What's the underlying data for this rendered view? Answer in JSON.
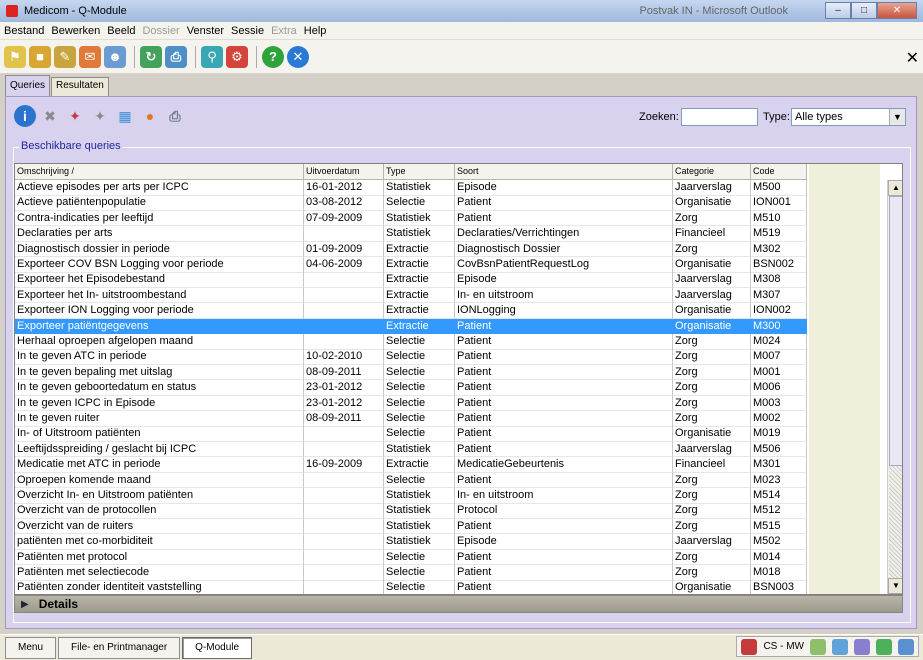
{
  "window": {
    "title": "Medicom - Q-Module",
    "blur_text": "Postvak IN - Microsoft Outlook"
  },
  "menu": {
    "items": [
      {
        "label": "Bestand",
        "enabled": true
      },
      {
        "label": "Bewerken",
        "enabled": true
      },
      {
        "label": "Beeld",
        "enabled": true
      },
      {
        "label": "Dossier",
        "enabled": false
      },
      {
        "label": "Venster",
        "enabled": true
      },
      {
        "label": "Sessie",
        "enabled": true
      },
      {
        "label": "Extra",
        "enabled": false
      },
      {
        "label": "Help",
        "enabled": true
      }
    ]
  },
  "tabs": [
    {
      "label": "Queries",
      "active": true
    },
    {
      "label": "Resultaten",
      "active": false
    }
  ],
  "search": {
    "label": "Zoeken:",
    "value": ""
  },
  "type_filter": {
    "label": "Type:",
    "value": "Alle types"
  },
  "group": {
    "title": "Beschikbare queries"
  },
  "grid": {
    "columns": [
      "Omschrijving /",
      "Uitvoerdatum",
      "Type",
      "Soort",
      "Categorie",
      "Code"
    ],
    "rows": [
      [
        "Actieve episodes per arts per ICPC",
        "16-01-2012",
        "Statistiek",
        "Episode",
        "Jaarverslag",
        "M500"
      ],
      [
        "Actieve patiëntenpopulatie",
        "03-08-2012",
        "Selectie",
        "Patient",
        "Organisatie",
        "ION001"
      ],
      [
        "Contra-indicaties per leeftijd",
        "07-09-2009",
        "Statistiek",
        "Patient",
        "Zorg",
        "M510"
      ],
      [
        "Declaraties per arts",
        "",
        "Statistiek",
        "Declaraties/Verrichtingen",
        "Financieel",
        "M519"
      ],
      [
        "Diagnostisch dossier in periode",
        "01-09-2009",
        "Extractie",
        "Diagnostisch Dossier",
        "Zorg",
        "M302"
      ],
      [
        "Exporteer COV BSN Logging voor periode",
        "04-06-2009",
        "Extractie",
        "CovBsnPatientRequestLog",
        "Organisatie",
        "BSN002"
      ],
      [
        "Exporteer het Episodebestand",
        "",
        "Extractie",
        "Episode",
        "Jaarverslag",
        "M308"
      ],
      [
        "Exporteer het In- uitstroombestand",
        "",
        "Extractie",
        "In- en uitstroom",
        "Jaarverslag",
        "M307"
      ],
      [
        "Exporteer ION Logging voor periode",
        "",
        "Extractie",
        "IONLogging",
        "Organisatie",
        "ION002"
      ],
      [
        "Exporteer patiëntgegevens",
        "",
        "Extractie",
        "Patient",
        "Organisatie",
        "M300"
      ],
      [
        "Herhaal oproepen afgelopen maand",
        "",
        "Selectie",
        "Patient",
        "Zorg",
        "M024"
      ],
      [
        "In te geven ATC in periode",
        "10-02-2010",
        "Selectie",
        "Patient",
        "Zorg",
        "M007"
      ],
      [
        "In te geven bepaling met uitslag",
        "08-09-2011",
        "Selectie",
        "Patient",
        "Zorg",
        "M001"
      ],
      [
        "In te geven geboortedatum en status",
        "23-01-2012",
        "Selectie",
        "Patient",
        "Zorg",
        "M006"
      ],
      [
        "In te geven ICPC in Episode",
        "23-01-2012",
        "Selectie",
        "Patient",
        "Zorg",
        "M003"
      ],
      [
        "In te geven ruiter",
        "08-09-2011",
        "Selectie",
        "Patient",
        "Zorg",
        "M002"
      ],
      [
        "In- of Uitstroom patiënten",
        "",
        "Selectie",
        "Patient",
        "Organisatie",
        "M019"
      ],
      [
        "Leeftijdsspreiding / geslacht bij ICPC",
        "",
        "Statistiek",
        "Patient",
        "Jaarverslag",
        "M506"
      ],
      [
        "Medicatie met ATC in periode",
        "16-09-2009",
        "Extractie",
        "MedicatieGebeurtenis",
        "Financieel",
        "M301"
      ],
      [
        "Oproepen komende maand",
        "",
        "Selectie",
        "Patient",
        "Zorg",
        "M023"
      ],
      [
        "Overzicht In- en Uitstroom patiënten",
        "",
        "Statistiek",
        "In- en uitstroom",
        "Zorg",
        "M514"
      ],
      [
        "Overzicht van de protocollen",
        "",
        "Statistiek",
        "Protocol",
        "Zorg",
        "M512"
      ],
      [
        "Overzicht van de ruiters",
        "",
        "Statistiek",
        "Patient",
        "Zorg",
        "M515"
      ],
      [
        "patiënten met co-morbiditeit",
        "",
        "Statistiek",
        "Episode",
        "Jaarverslag",
        "M502"
      ],
      [
        "Patiënten met protocol",
        "",
        "Selectie",
        "Patient",
        "Zorg",
        "M014"
      ],
      [
        "Patiënten met selectiecode",
        "",
        "Selectie",
        "Patient",
        "Zorg",
        "M018"
      ],
      [
        "Patiënten zonder identiteit vaststelling",
        "",
        "Selectie",
        "Patient",
        "Organisatie",
        "BSN003"
      ]
    ],
    "selected_index": 9
  },
  "details": {
    "label": "Details"
  },
  "taskbar": {
    "buttons": [
      {
        "label": "Menu",
        "active": false
      },
      {
        "label": "File- en Printmanager",
        "active": false
      },
      {
        "label": "Q-Module",
        "active": true
      }
    ],
    "tray_label": "CS - MW"
  }
}
